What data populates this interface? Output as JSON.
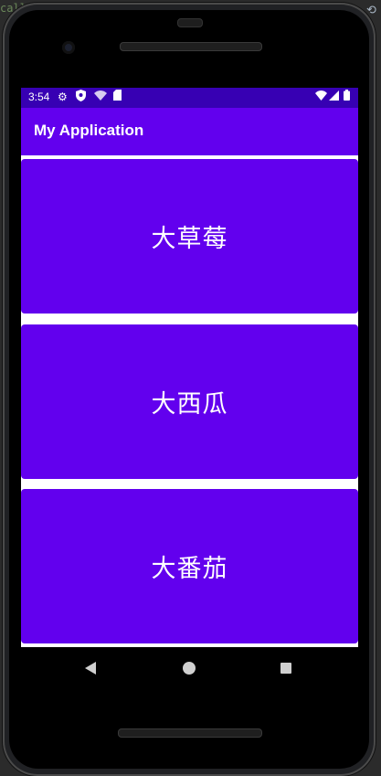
{
  "ide": {
    "code_fragment": "call"
  },
  "status_bar": {
    "time": "3:54",
    "left_icons": [
      "settings-icon",
      "shield-icon",
      "wifi-icon",
      "sd-card-icon"
    ],
    "right_icons": [
      "wifi-signal-icon",
      "cell-signal-icon",
      "battery-icon"
    ]
  },
  "app_bar": {
    "title": "My Application"
  },
  "cards": [
    {
      "label": "大草莓"
    },
    {
      "label": "大西瓜"
    },
    {
      "label": "大番茄"
    }
  ],
  "nav_bar": {
    "buttons": [
      "back",
      "home",
      "recents"
    ]
  },
  "colors": {
    "primary": "#6200ee",
    "primary_dark": "#3700b3",
    "on_primary": "#ffffff"
  }
}
